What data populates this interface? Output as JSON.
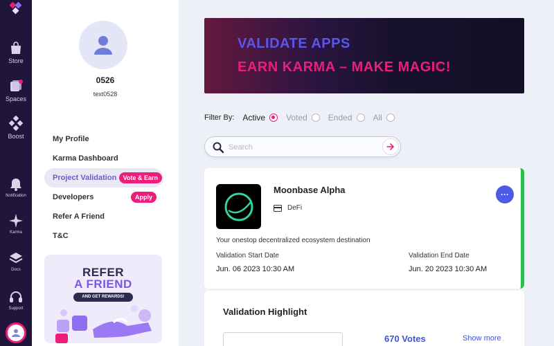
{
  "rail": {
    "items": [
      {
        "label": "Store",
        "icon": "bag-icon"
      },
      {
        "label": "Spaces",
        "icon": "spaces-icon"
      },
      {
        "label": "Boost",
        "icon": "boost-icon"
      },
      {
        "label": "Notification",
        "icon": "bell-icon"
      },
      {
        "label": "Karma",
        "icon": "sparkle-icon"
      },
      {
        "label": "Docs",
        "icon": "layers-icon"
      },
      {
        "label": "Support",
        "icon": "headset-icon"
      }
    ]
  },
  "profile": {
    "name": "0526",
    "handle": "text0528"
  },
  "nav": {
    "items": [
      {
        "label": "My Profile"
      },
      {
        "label": "Karma Dashboard"
      },
      {
        "label": "Project Validation",
        "badge": "Vote & Earn",
        "active": true
      },
      {
        "label": "Developers",
        "badge": "Apply"
      },
      {
        "label": "Refer A Friend"
      },
      {
        "label": "T&C"
      }
    ]
  },
  "refer": {
    "line1": "REFER",
    "line2": "A FRIEND",
    "tag": "AND GET REWARDS!"
  },
  "banner": {
    "line1": "VALIDATE APPS",
    "line2": "EARN KARMA – MAKE MAGIC!"
  },
  "filter": {
    "label": "Filter By:",
    "options": [
      "Active",
      "Voted",
      "Ended",
      "All"
    ],
    "selected": "Active"
  },
  "search": {
    "placeholder": "Search",
    "value": ""
  },
  "project": {
    "name": "Moonbase Alpha",
    "category": "DeFi",
    "description": "Your onestop decentralized ecosystem destination",
    "start_label": "Validation Start Date",
    "start_value": "Jun. 06 2023 10:30 AM",
    "end_label": "Validation End Date",
    "end_value": "Jun. 20 2023 10:30 AM",
    "more_symbol": "···"
  },
  "highlight": {
    "title": "Validation Highlight",
    "votes": "670 Votes",
    "show_more": "Show more"
  },
  "colors": {
    "accent_pink": "#ec1d7b",
    "accent_blue": "#4b5be7",
    "rail_bg": "#20153a",
    "status_green": "#2fbd4f"
  }
}
